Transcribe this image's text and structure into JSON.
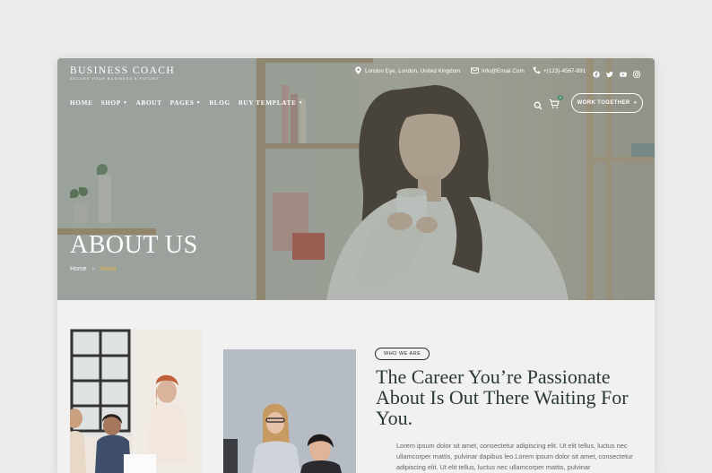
{
  "brand": {
    "title": "BUSINESS COACH",
    "tagline": "SECURE YOUR BUSINESS'S FUTURE"
  },
  "contact": {
    "address": "London Eye, London, United Kingdom",
    "email": "Info@Email.Com",
    "phone": "+(123)-4567-891"
  },
  "social_icons": [
    "facebook-icon",
    "twitter-icon",
    "youtube-icon",
    "instagram-icon"
  ],
  "nav": {
    "items": [
      {
        "label": "HOME",
        "dropdown": false
      },
      {
        "label": "SHOP",
        "dropdown": true
      },
      {
        "label": "ABOUT",
        "dropdown": false
      },
      {
        "label": "PAGES",
        "dropdown": true
      },
      {
        "label": "BLOG",
        "dropdown": false
      },
      {
        "label": "BUY TEMPLATE",
        "dropdown": true
      }
    ],
    "cart_count": "0",
    "cta_label": "WORK TOGETHER",
    "cta_arrow": "»"
  },
  "hero": {
    "title": "ABOUT US",
    "breadcrumb": {
      "home": "Home",
      "separator": "›",
      "current": "About"
    }
  },
  "about": {
    "tag": "WHO WE ARE",
    "heading": "The Career You’re Passionate About Is Out There Waiting For You.",
    "body": "Lorem ipsum dolor sit amet, consectetur adipiscing elit. Ut elit tellus, luctus nec ullamcorper mattis, pulvinar dapibus leo.Lorem ipsum dolor sit amet, consectetur adipiscing elit. Ut elit tellus, luctus nec ullamcorper mattis, pulvinar"
  },
  "colors": {
    "accent_gold": "#e8b34c",
    "heading_dark_green": "#2b3a35",
    "badge_green": "#4a8c6e"
  }
}
